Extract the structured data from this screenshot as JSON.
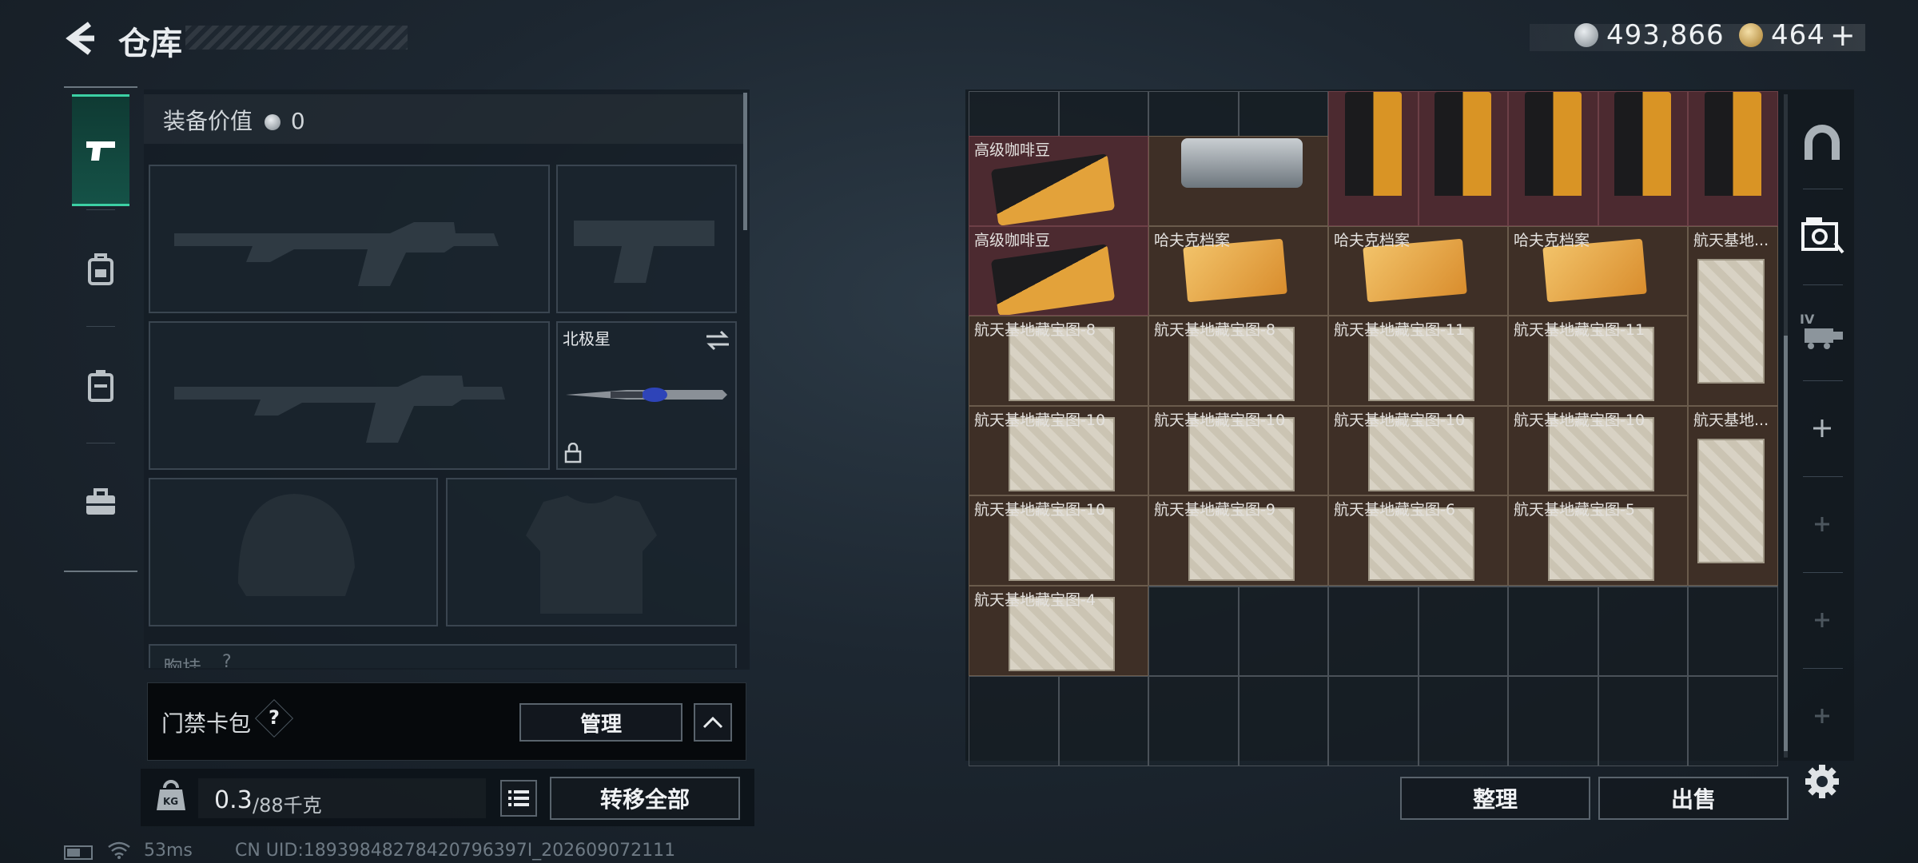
{
  "header": {
    "title": "仓库",
    "silver_amount": "493,866",
    "gold_amount": "464",
    "add_label": "+"
  },
  "colors": {
    "accent": "#3cd0a4",
    "rare_item_bg": "#4c2a30",
    "item_bg": "#3e2f26"
  },
  "left_tabs": [
    {
      "name": "weapons",
      "icon": "pistol-icon",
      "active": true
    },
    {
      "name": "backpack",
      "icon": "backpack-icon",
      "active": false
    },
    {
      "name": "armor-rig",
      "icon": "rig-icon",
      "active": false
    },
    {
      "name": "tools",
      "icon": "toolbox-icon",
      "active": false
    }
  ],
  "equipment": {
    "value_label": "装备价值",
    "value": "0",
    "melee_name": "北极星",
    "chest_rig_label": "胸挂",
    "chest_rig_hint": "?"
  },
  "keycard": {
    "label": "门禁卡包",
    "help": "?",
    "manage_button": "管理"
  },
  "weight": {
    "icon_text": "KG",
    "current": "0.3",
    "capacity": "/88千克",
    "transfer_all_button": "转移全部"
  },
  "stash": {
    "items": [
      {
        "name": "高级咖啡豆",
        "label": "高级咖啡豆",
        "style": "red"
      },
      {
        "name": "camcorder",
        "label": "",
        "style": "brown"
      },
      {
        "name": "coffee-bag-1",
        "label": "",
        "style": "red"
      },
      {
        "name": "coffee-bag-2",
        "label": "",
        "style": "red"
      },
      {
        "name": "coffee-bag-3",
        "label": "",
        "style": "red"
      },
      {
        "name": "coffee-bag-4",
        "label": "",
        "style": "red"
      },
      {
        "name": "coffee-bag-5",
        "label": "",
        "style": "red"
      },
      {
        "name": "高级咖啡豆-2",
        "label": "高级咖啡豆",
        "style": "red"
      },
      {
        "name": "哈夫克档案-1",
        "label": "哈夫克档案",
        "style": "brown"
      },
      {
        "name": "哈夫克档案-2",
        "label": "哈夫克档案",
        "style": "brown"
      },
      {
        "name": "哈夫克档案-3",
        "label": "哈夫克档案",
        "style": "brown"
      },
      {
        "name": "航天基地-tall-1",
        "label": "航天基地...",
        "style": "brown"
      },
      {
        "name": "map-8a",
        "label": "航天基地藏宝图-8",
        "style": "brown"
      },
      {
        "name": "map-8b",
        "label": "航天基地藏宝图-8",
        "style": "brown"
      },
      {
        "name": "map-11a",
        "label": "航天基地藏宝图-11",
        "style": "brown"
      },
      {
        "name": "map-11b",
        "label": "航天基地藏宝图-11",
        "style": "brown"
      },
      {
        "name": "map-10a",
        "label": "航天基地藏宝图-10",
        "style": "brown"
      },
      {
        "name": "map-10b",
        "label": "航天基地藏宝图-10",
        "style": "brown"
      },
      {
        "name": "map-10c",
        "label": "航天基地藏宝图-10",
        "style": "brown"
      },
      {
        "name": "map-10d",
        "label": "航天基地藏宝图-10",
        "style": "brown"
      },
      {
        "name": "航天基地-tall-2",
        "label": "航天基地...",
        "style": "brown"
      },
      {
        "name": "map-10e",
        "label": "航天基地藏宝图-10",
        "style": "brown"
      },
      {
        "name": "map-9",
        "label": "航天基地藏宝图-9",
        "style": "brown"
      },
      {
        "name": "map-6",
        "label": "航天基地藏宝图-6",
        "style": "brown"
      },
      {
        "name": "map-5",
        "label": "航天基地藏宝图-5",
        "style": "brown"
      },
      {
        "name": "map-4",
        "label": "航天基地藏宝图-4",
        "style": "brown"
      }
    ],
    "sort_button": "整理",
    "sell_button": "出售"
  },
  "right_tabs": [
    "helmet-shelf-icon",
    "vault-camera-icon",
    "level-iv-tab-icon",
    "plus-icon",
    "plus-icon",
    "plus-icon",
    "plus-icon",
    "gear-icon"
  ],
  "status": {
    "ping": "53ms",
    "uid": "CN UID:18939848278420796397I_202609072111"
  }
}
